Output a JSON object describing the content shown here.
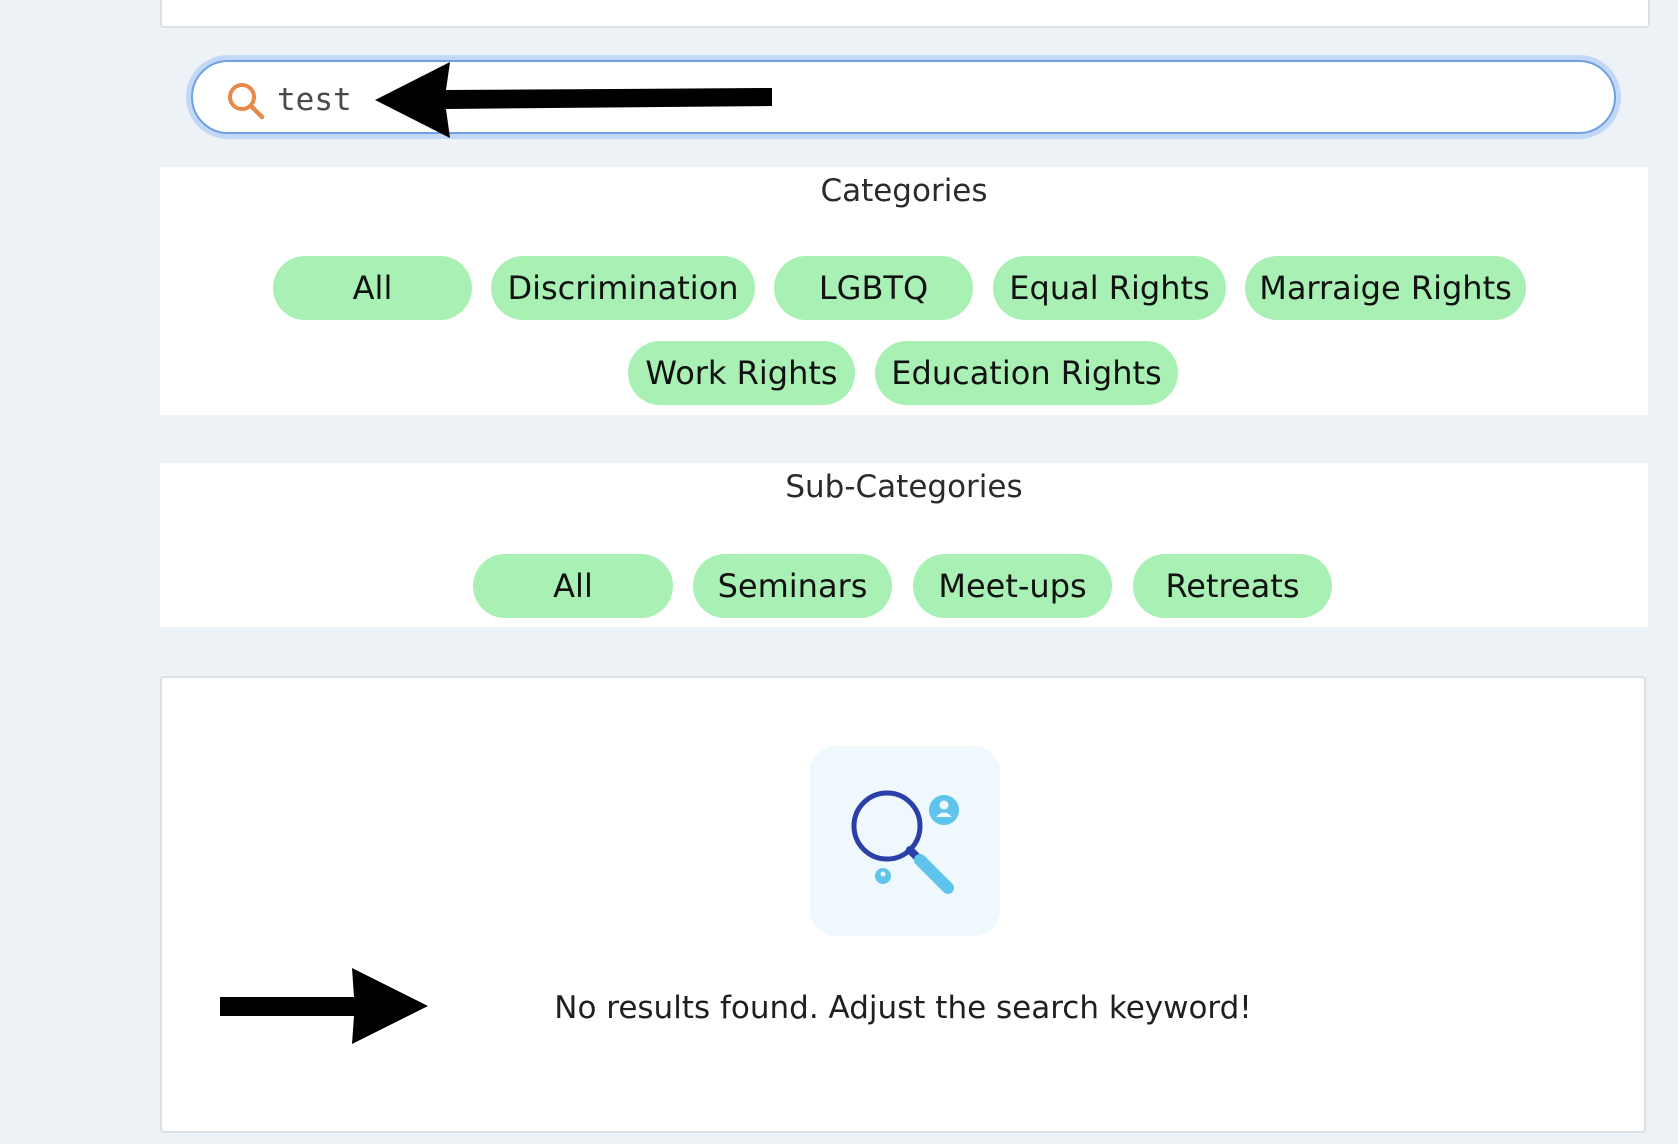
{
  "search": {
    "value": "test",
    "placeholder": ""
  },
  "categories": {
    "title": "Categories",
    "items": [
      "All",
      "Discrimination",
      "LGBTQ",
      "Equal Rights",
      "Marraige Rights",
      "Work Rights",
      "Education Rights"
    ]
  },
  "subcategories": {
    "title": "Sub-Categories",
    "items": [
      "All",
      "Seminars",
      "Meet-ups",
      "Retreats"
    ]
  },
  "results": {
    "empty_message": "No results found. Adjust the search keyword!"
  },
  "colors": {
    "page_background": "#edf2f7",
    "chip_background": "#a8f0b3",
    "search_focus_ring": "#6f9fe6",
    "search_icon": "#e8894a",
    "illustration_primary": "#2b3fa8",
    "illustration_accent": "#5fc4ec"
  },
  "icons": {
    "search": "search-icon",
    "empty_state": "no-results-magnifier-icon",
    "annotation_left": "arrow-left-icon",
    "annotation_right": "arrow-right-icon"
  }
}
